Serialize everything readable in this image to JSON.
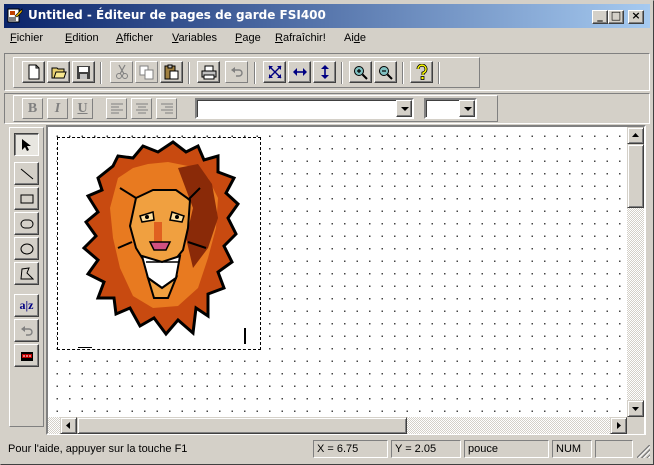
{
  "window": {
    "title": "Untitled - Éditeur de pages de garde FSI400",
    "minimize": "_",
    "maximize": "□",
    "close": "×"
  },
  "menu": {
    "items": [
      {
        "pre": "",
        "key": "F",
        "post": "ichier"
      },
      {
        "pre": "",
        "key": "E",
        "post": "dition"
      },
      {
        "pre": "",
        "key": "A",
        "post": "fficher"
      },
      {
        "pre": "",
        "key": "V",
        "post": "ariables"
      },
      {
        "pre": "",
        "key": "P",
        "post": "age"
      },
      {
        "pre": "",
        "key": "R",
        "post": "afraîchir!"
      },
      {
        "pre": "Ai",
        "key": "d",
        "post": "e"
      }
    ]
  },
  "format_bar": {
    "bold": "B",
    "italic": "I",
    "underline": "U",
    "font_value": "",
    "size_value": ""
  },
  "palette": {
    "text_tool": "a|z"
  },
  "statusbar": {
    "help": "Pour l'aide, appuyer sur la touche F1",
    "x": "X = 6.75",
    "y": "Y = 2.05",
    "unit": "pouce",
    "num": "NUM"
  },
  "colors": {
    "titlebar_start": "#0a246a",
    "titlebar_end": "#a6caf0",
    "face": "#d4d0c8"
  }
}
